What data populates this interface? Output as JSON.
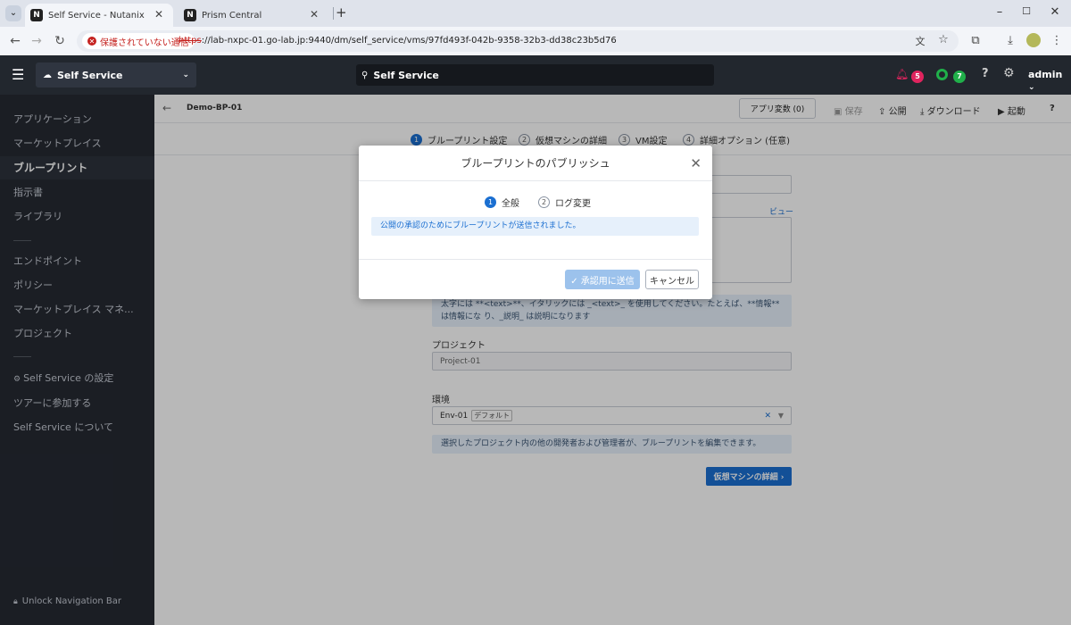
{
  "browser": {
    "tabs": [
      {
        "title": "Self Service - Nutanix",
        "favicon": "nutanix-icon"
      },
      {
        "title": "Prism Central",
        "favicon": "nutanix-icon"
      }
    ],
    "security_label": "保護されていない通信",
    "url_scheme": "https",
    "url_rest": "://lab-nxpc-01.go-lab.jp:9440/dm/self_service/vms/97fd493f-042b-9358-32b3-dd38c23b5d76",
    "danger_color": "#c5221f"
  },
  "app": {
    "app_selector": "Self Service",
    "search_text": "Self Service",
    "alert_count": "5",
    "task_count": "7",
    "user": "admin",
    "alert_color": "#e0245e",
    "task_color": "#20b04a"
  },
  "sidebar": {
    "items": [
      {
        "label": "アプリケーション"
      },
      {
        "label": "マーケットプレイス"
      },
      {
        "label": "ブループリント",
        "active": true
      },
      {
        "label": "指示書"
      },
      {
        "label": "ライブラリ"
      },
      {
        "label": "エンドポイント"
      },
      {
        "label": "ポリシー"
      },
      {
        "label": "マーケットプレイス マネ..."
      },
      {
        "label": "プロジェクト"
      },
      {
        "label": "Self Service の設定"
      },
      {
        "label": "ツアーに参加する"
      },
      {
        "label": "Self Service について"
      }
    ],
    "unlock": "Unlock Navigation Bar"
  },
  "toolbar": {
    "blueprint_name": "Demo-BP-01",
    "app_vars": "アプリ変数 (0)",
    "save": "保存",
    "publish": "公開",
    "download": "ダウンロード",
    "launch": "起動",
    "help": "?"
  },
  "steps": [
    {
      "num": "1",
      "label": "ブループリント設定"
    },
    {
      "num": "2",
      "label": "仮想マシンの詳細"
    },
    {
      "num": "3",
      "label": "VM設定"
    },
    {
      "num": "4",
      "label": "詳細オプション (任意)"
    }
  ],
  "form": {
    "preview_link": "ビュー",
    "markdown_hint": "太字には **<text>**、イタリックには _<text>_ を使用してください。たとえば、**情報** は情報にな り、_説明_ は説明になります",
    "project_label": "プロジェクト",
    "project_value": "Project-01",
    "env_label": "環境",
    "env_value": "Env-01",
    "env_tag": "デフォルト",
    "edit_info": "選択したプロジェクト内の他の開発者および管理者が、ブループリントを編集できます。",
    "next_button": "仮想マシンの詳細 ›"
  },
  "modal": {
    "title": "ブループリントのパブリッシュ",
    "steps": [
      {
        "num": "1",
        "label": "全般"
      },
      {
        "num": "2",
        "label": "ログ変更"
      }
    ],
    "info": "公開の承認のためにブループリントが送信されました。",
    "submit": "✓ 承認用に送信",
    "cancel": "キャンセル",
    "accent": "#1b6fd1"
  }
}
